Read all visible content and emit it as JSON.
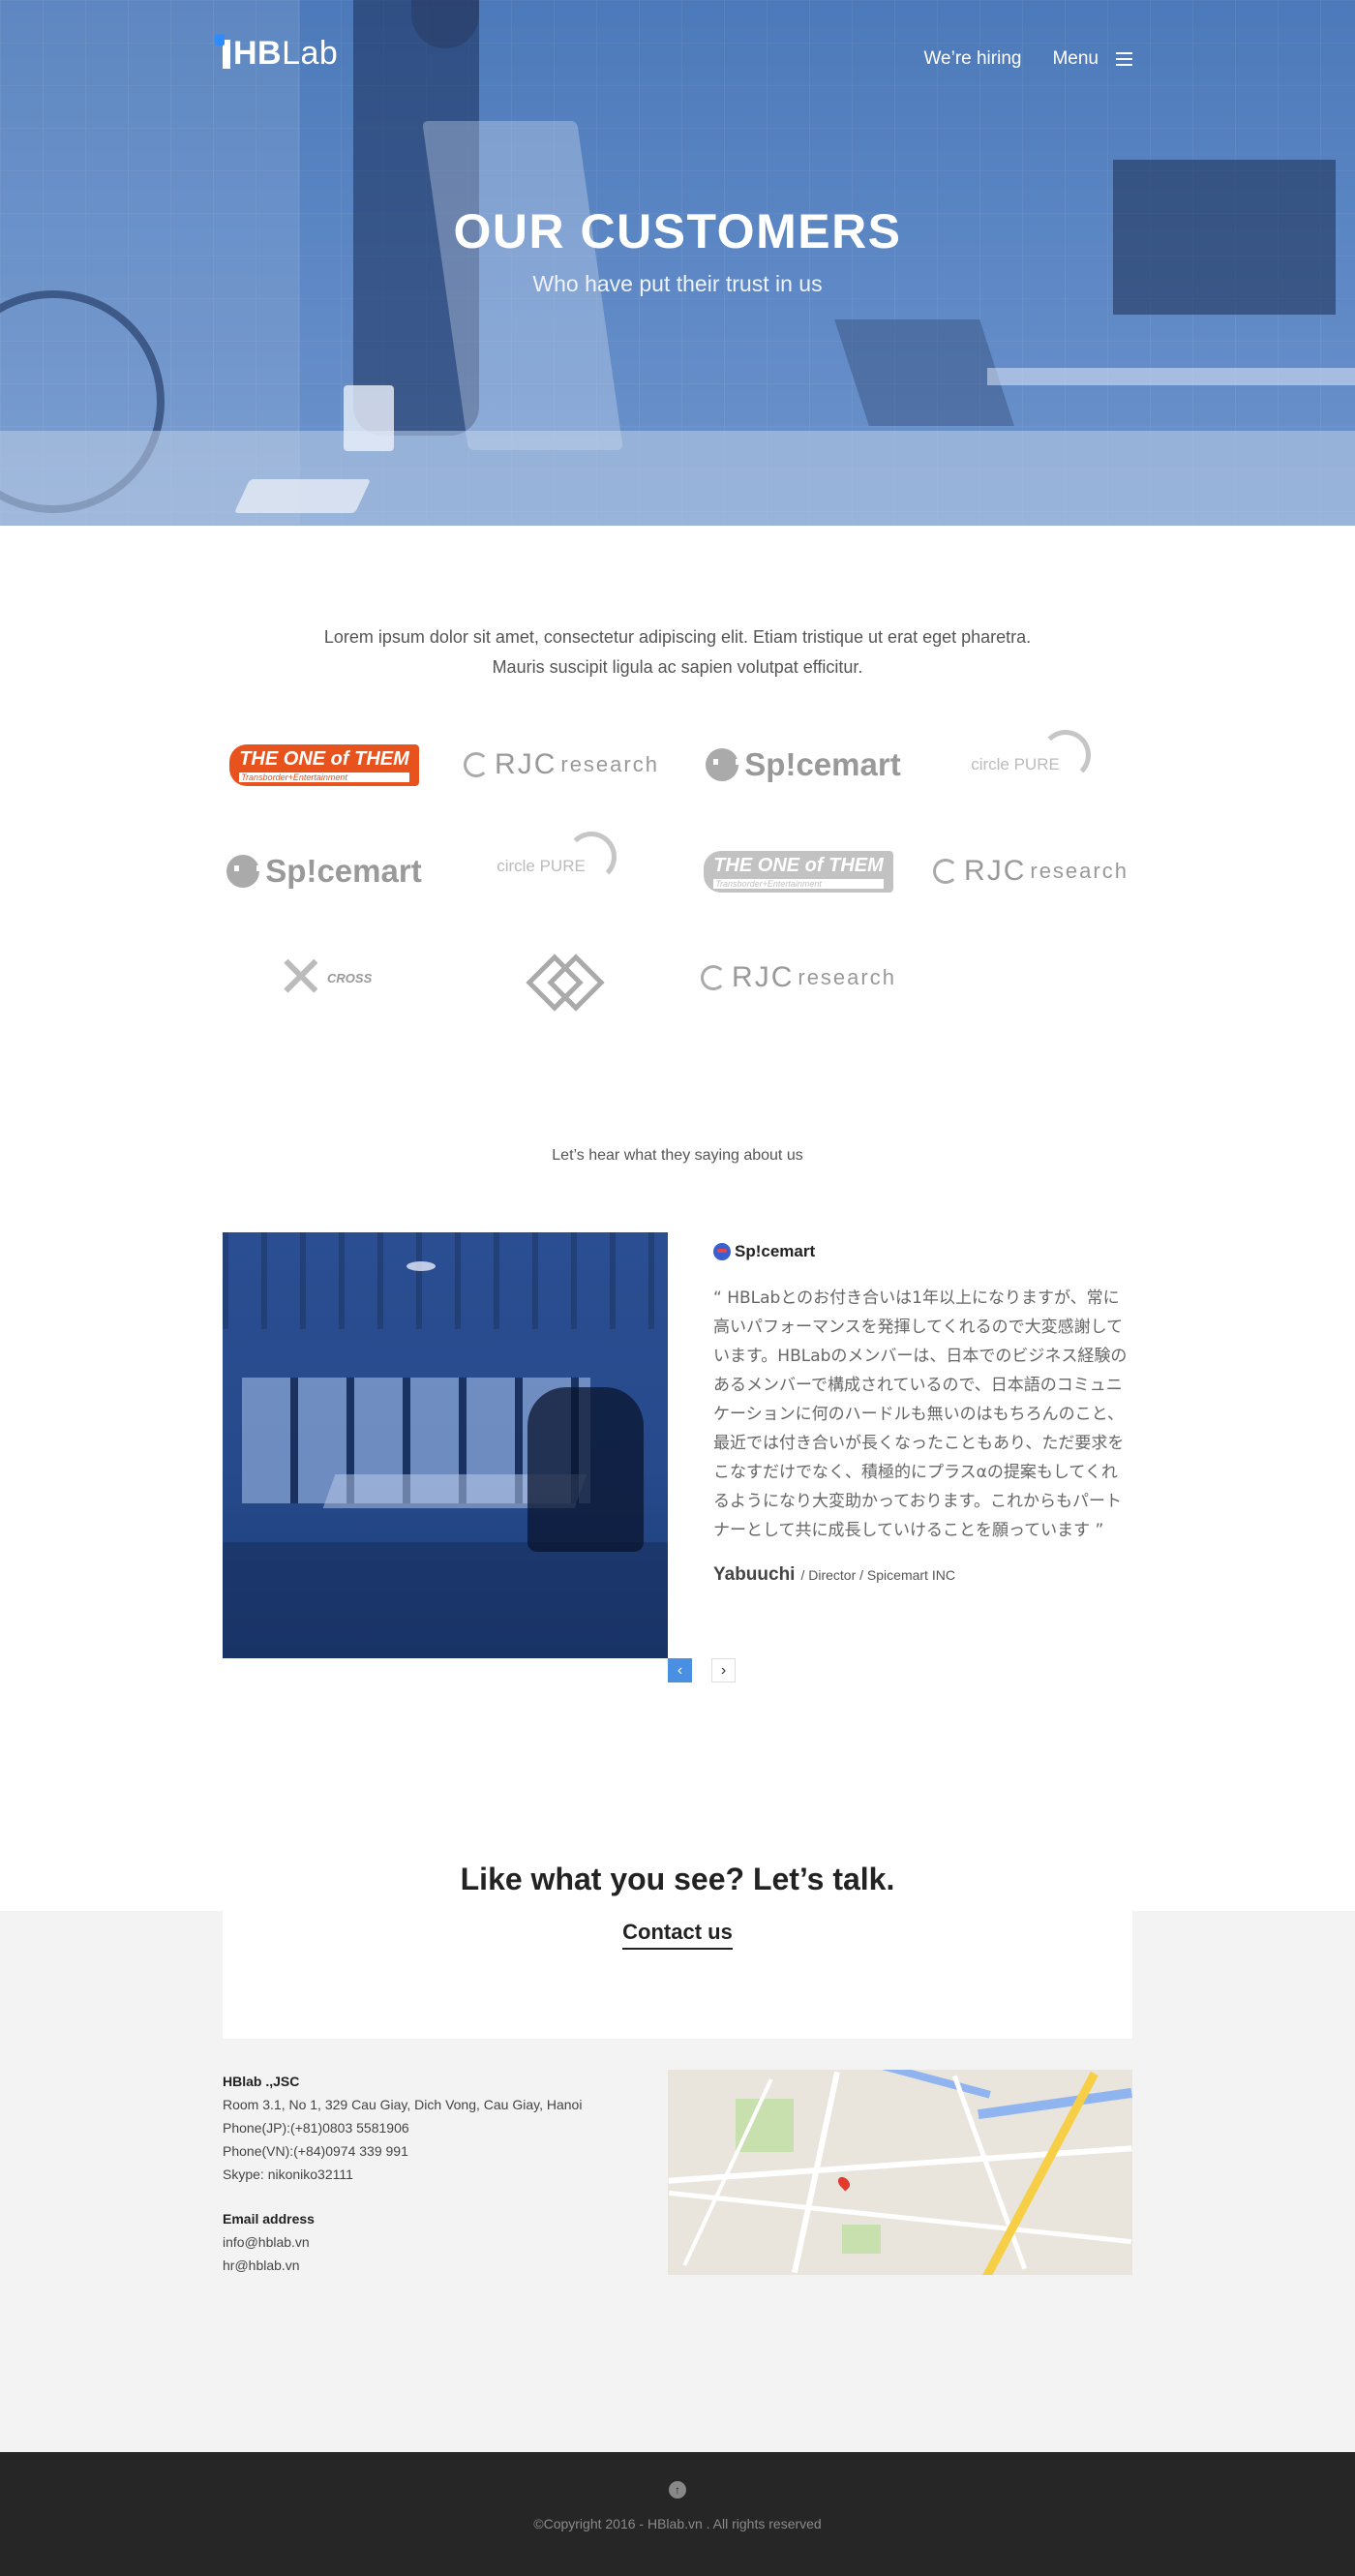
{
  "header": {
    "logo_text_bold": "HB",
    "logo_text": "Lab",
    "nav_hiring": "We’re hiring",
    "nav_menu": "Menu"
  },
  "hero": {
    "title": "OUR CUSTOMERS",
    "subtitle": "Who have put their trust in us"
  },
  "customers": {
    "intro_line1": "Lorem ipsum dolor sit amet, consectetur adipiscing elit. Etiam tristique ut erat eget pharetra.",
    "intro_line2": "Mauris suscipit ligula ac sapien volutpat efficitur.",
    "logos": [
      {
        "name": "THE ONE of THEM",
        "tagline": "Transborder+Entertainment"
      },
      {
        "name": "RJC",
        "suffix": "research"
      },
      {
        "name": "Sp!cemart"
      },
      {
        "name": "circle PURE"
      },
      {
        "name": "Sp!cemart"
      },
      {
        "name": "circle PURE"
      },
      {
        "name": "THE ONE of THEM",
        "tagline": "Transborder+Entertainment"
      },
      {
        "name": "RJC",
        "suffix": "research"
      },
      {
        "name": "CROSS"
      },
      {
        "name": "diamond-logo"
      },
      {
        "name": "RJC",
        "suffix": "research"
      }
    ]
  },
  "testimonial": {
    "section_title": "Let’s hear what they saying about us",
    "logo": "Sp!cemart",
    "quote": "“ HBLabとのお付き合いは1年以上になりますが、常に高いパフォーマンスを発揮してくれるので大変感謝しています。HBLabのメンバーは、日本でのビジネス経験のあるメンバーで構成されているので、日本語のコミュニケーションに何のハードルも無いのはもちろんのこと、最近では付き合いが長くなったこともあり、ただ要求をこなすだけでなく、積極的にプラスαの提案もしてくれるようになり大変助かっております。これからもパートナーとして共に成長していけることを願っています ”",
    "author_name": "Yabuuchi",
    "author_role": "/ Director / Spicemart INC",
    "prev_icon": "chevron-left-icon",
    "next_icon": "chevron-right-icon"
  },
  "cta": {
    "title": "Like what you see? Let’s talk.",
    "link": "Contact us"
  },
  "contact": {
    "company": "HBlab .,JSC",
    "address": "Room 3.1, No 1, 329 Cau Giay, Dich Vong, Cau Giay, Hanoi",
    "phone_jp": "Phone(JP):(+81)0803 5581906",
    "phone_vn": "Phone(VN):(+84)0974 339 991",
    "skype": "Skype: nikoniko32111",
    "email_heading": "Email address",
    "email1": "info@hblab.vn",
    "email2": "hr@hblab.vn"
  },
  "footer": {
    "copyright": "©Copyright 2016 - HBlab.vn . All rights reserved"
  },
  "colors": {
    "hero_blue": "#5b86c4",
    "accent_blue": "#4a90e2",
    "footer_bg": "#262626",
    "cta_bg": "#f3f3f3",
    "theone_orange": "#e8521c"
  }
}
